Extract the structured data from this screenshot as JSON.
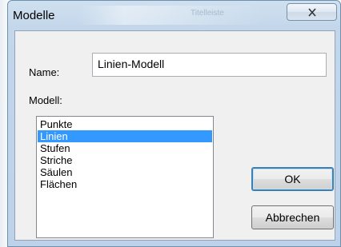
{
  "window": {
    "title": "Modelle",
    "blurred_title": "Titelleiste",
    "close_icon": "close-icon"
  },
  "form": {
    "name_label": "Name:",
    "name_value": "Linien-Modell",
    "modell_label": "Modell:"
  },
  "list": {
    "items": [
      "Punkte",
      "Linien",
      "Stufen",
      "Striche",
      "Säulen",
      "Flächen"
    ],
    "selected": "Linien"
  },
  "buttons": {
    "ok_label": "OK",
    "cancel_label": "Abbrechen"
  },
  "colors": {
    "selection": "#3399ff",
    "title_gradient": "#c3d6ea",
    "client_bg": "#f0f0f0"
  }
}
